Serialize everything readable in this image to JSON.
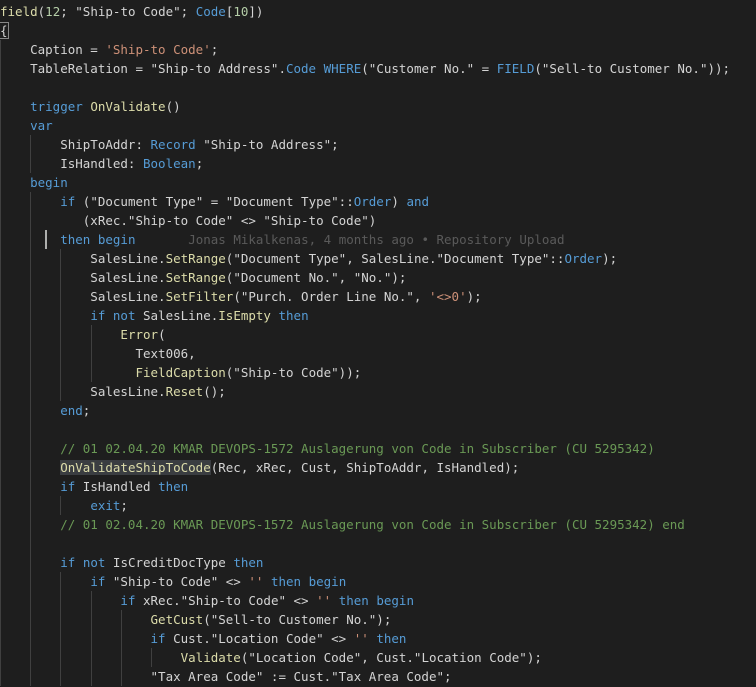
{
  "editor": {
    "language": "AL",
    "blame_annotation": "Jonas Mikalkenas, 4 months ago • Repository Upload",
    "lines": [
      [
        {
          "t": "field",
          "c": "fn"
        },
        {
          "t": "(",
          "c": "txt"
        },
        {
          "t": "12",
          "c": "num"
        },
        {
          "t": "; \"Ship-to Code\"; ",
          "c": "txt"
        },
        {
          "t": "Code",
          "c": "kw"
        },
        {
          "t": "[",
          "c": "txt"
        },
        {
          "t": "10",
          "c": "num"
        },
        {
          "t": "])",
          "c": "txt"
        }
      ],
      [
        {
          "t": "{",
          "c": "txt"
        }
      ],
      [
        {
          "t": "    Caption = ",
          "c": "txt"
        },
        {
          "t": "'Ship-to Code'",
          "c": "str"
        },
        {
          "t": ";",
          "c": "txt"
        }
      ],
      [
        {
          "t": "    TableRelation = \"Ship-to Address\".",
          "c": "txt"
        },
        {
          "t": "Code",
          "c": "kw"
        },
        {
          "t": " ",
          "c": "txt"
        },
        {
          "t": "WHERE",
          "c": "kw"
        },
        {
          "t": "(\"Customer No.\" = ",
          "c": "txt"
        },
        {
          "t": "FIELD",
          "c": "kw"
        },
        {
          "t": "(\"Sell-to Customer No.\"));",
          "c": "txt"
        }
      ],
      [],
      [
        {
          "t": "    ",
          "c": "txt"
        },
        {
          "t": "trigger",
          "c": "kw"
        },
        {
          "t": " ",
          "c": "txt"
        },
        {
          "t": "OnValidate",
          "c": "fn"
        },
        {
          "t": "()",
          "c": "txt"
        }
      ],
      [
        {
          "t": "    ",
          "c": "txt"
        },
        {
          "t": "var",
          "c": "kw"
        }
      ],
      [
        {
          "t": "        ShipToAddr: ",
          "c": "txt"
        },
        {
          "t": "Record",
          "c": "kw"
        },
        {
          "t": " \"Ship-to Address\";",
          "c": "txt"
        }
      ],
      [
        {
          "t": "        IsHandled: ",
          "c": "txt"
        },
        {
          "t": "Boolean",
          "c": "kw"
        },
        {
          "t": ";",
          "c": "txt"
        }
      ],
      [
        {
          "t": "    ",
          "c": "txt"
        },
        {
          "t": "begin",
          "c": "kw"
        }
      ],
      [
        {
          "t": "        ",
          "c": "txt"
        },
        {
          "t": "if",
          "c": "kw"
        },
        {
          "t": " (\"Document Type\" = \"Document Type\"::",
          "c": "txt"
        },
        {
          "t": "Order",
          "c": "kw"
        },
        {
          "t": ") ",
          "c": "txt"
        },
        {
          "t": "and",
          "c": "kw"
        }
      ],
      [
        {
          "t": "           (xRec.\"Ship-to Code\" <> \"Ship-to Code\")",
          "c": "txt"
        }
      ],
      [
        {
          "t": "        ",
          "c": "txt"
        },
        {
          "t": "then",
          "c": "kw"
        },
        {
          "t": " ",
          "c": "txt"
        },
        {
          "t": "begin",
          "c": "kw"
        },
        {
          "t": "       ",
          "c": "txt"
        },
        {
          "t": "@blame",
          "c": "blame"
        }
      ],
      [
        {
          "t": "            SalesLine.",
          "c": "txt"
        },
        {
          "t": "SetRange",
          "c": "fn"
        },
        {
          "t": "(\"Document Type\", SalesLine.\"Document Type\"::",
          "c": "txt"
        },
        {
          "t": "Order",
          "c": "kw"
        },
        {
          "t": ");",
          "c": "txt"
        }
      ],
      [
        {
          "t": "            SalesLine.",
          "c": "txt"
        },
        {
          "t": "SetRange",
          "c": "fn"
        },
        {
          "t": "(\"Document No.\", \"No.\");",
          "c": "txt"
        }
      ],
      [
        {
          "t": "            SalesLine.",
          "c": "txt"
        },
        {
          "t": "SetFilter",
          "c": "fn"
        },
        {
          "t": "(\"Purch. Order Line No.\", ",
          "c": "txt"
        },
        {
          "t": "'<>0'",
          "c": "str"
        },
        {
          "t": ");",
          "c": "txt"
        }
      ],
      [
        {
          "t": "            ",
          "c": "txt"
        },
        {
          "t": "if",
          "c": "kw"
        },
        {
          "t": " ",
          "c": "txt"
        },
        {
          "t": "not",
          "c": "kw"
        },
        {
          "t": " SalesLine.",
          "c": "txt"
        },
        {
          "t": "IsEmpty",
          "c": "fn"
        },
        {
          "t": " ",
          "c": "txt"
        },
        {
          "t": "then",
          "c": "kw"
        }
      ],
      [
        {
          "t": "                ",
          "c": "txt"
        },
        {
          "t": "Error",
          "c": "fn"
        },
        {
          "t": "(",
          "c": "txt"
        }
      ],
      [
        {
          "t": "                  Text006,",
          "c": "txt"
        }
      ],
      [
        {
          "t": "                  ",
          "c": "txt"
        },
        {
          "t": "FieldCaption",
          "c": "fn"
        },
        {
          "t": "(\"Ship-to Code\"));",
          "c": "txt"
        }
      ],
      [
        {
          "t": "            SalesLine.",
          "c": "txt"
        },
        {
          "t": "Reset",
          "c": "fn"
        },
        {
          "t": "();",
          "c": "txt"
        }
      ],
      [
        {
          "t": "        ",
          "c": "txt"
        },
        {
          "t": "end",
          "c": "kw"
        },
        {
          "t": ";",
          "c": "txt"
        }
      ],
      [],
      [
        {
          "t": "        // 01 02.04.20 KMAR DEVOPS-1572 Auslagerung von Code in Subscriber (CU 5295342)",
          "c": "cmt"
        }
      ],
      [
        {
          "t": "        ",
          "c": "txt"
        },
        {
          "t": "OnValidateShipToCode",
          "c": "fn",
          "hl": true
        },
        {
          "t": "(Rec, xRec, Cust, ShipToAddr, IsHandled);",
          "c": "txt"
        }
      ],
      [
        {
          "t": "        ",
          "c": "txt"
        },
        {
          "t": "if",
          "c": "kw"
        },
        {
          "t": " IsHandled ",
          "c": "txt"
        },
        {
          "t": "then",
          "c": "kw"
        }
      ],
      [
        {
          "t": "            ",
          "c": "txt"
        },
        {
          "t": "exit",
          "c": "kw"
        },
        {
          "t": ";",
          "c": "txt"
        }
      ],
      [
        {
          "t": "        // 01 02.04.20 KMAR DEVOPS-1572 Auslagerung von Code in Subscriber (CU 5295342) end",
          "c": "cmt"
        }
      ],
      [],
      [
        {
          "t": "        ",
          "c": "txt"
        },
        {
          "t": "if",
          "c": "kw"
        },
        {
          "t": " ",
          "c": "txt"
        },
        {
          "t": "not",
          "c": "kw"
        },
        {
          "t": " IsCreditDocType ",
          "c": "txt"
        },
        {
          "t": "then",
          "c": "kw"
        }
      ],
      [
        {
          "t": "            ",
          "c": "txt"
        },
        {
          "t": "if",
          "c": "kw"
        },
        {
          "t": " \"Ship-to Code\" <> ",
          "c": "txt"
        },
        {
          "t": "''",
          "c": "str"
        },
        {
          "t": " ",
          "c": "txt"
        },
        {
          "t": "then",
          "c": "kw"
        },
        {
          "t": " ",
          "c": "txt"
        },
        {
          "t": "begin",
          "c": "kw"
        }
      ],
      [
        {
          "t": "                ",
          "c": "txt"
        },
        {
          "t": "if",
          "c": "kw"
        },
        {
          "t": " xRec.\"Ship-to Code\" <> ",
          "c": "txt"
        },
        {
          "t": "''",
          "c": "str"
        },
        {
          "t": " ",
          "c": "txt"
        },
        {
          "t": "then",
          "c": "kw"
        },
        {
          "t": " ",
          "c": "txt"
        },
        {
          "t": "begin",
          "c": "kw"
        }
      ],
      [
        {
          "t": "                    ",
          "c": "txt"
        },
        {
          "t": "GetCust",
          "c": "fn"
        },
        {
          "t": "(\"Sell-to Customer No.\");",
          "c": "txt"
        }
      ],
      [
        {
          "t": "                    ",
          "c": "txt"
        },
        {
          "t": "if",
          "c": "kw"
        },
        {
          "t": " Cust.\"Location Code\" <> ",
          "c": "txt"
        },
        {
          "t": "''",
          "c": "str"
        },
        {
          "t": " ",
          "c": "txt"
        },
        {
          "t": "then",
          "c": "kw"
        }
      ],
      [
        {
          "t": "                        ",
          "c": "txt"
        },
        {
          "t": "Validate",
          "c": "fn"
        },
        {
          "t": "(\"Location Code\", Cust.\"Location Code\");",
          "c": "txt"
        }
      ],
      [
        {
          "t": "                    \"Tax Area Code\" := Cust.\"Tax Area Code\";",
          "c": "txt"
        }
      ]
    ]
  }
}
